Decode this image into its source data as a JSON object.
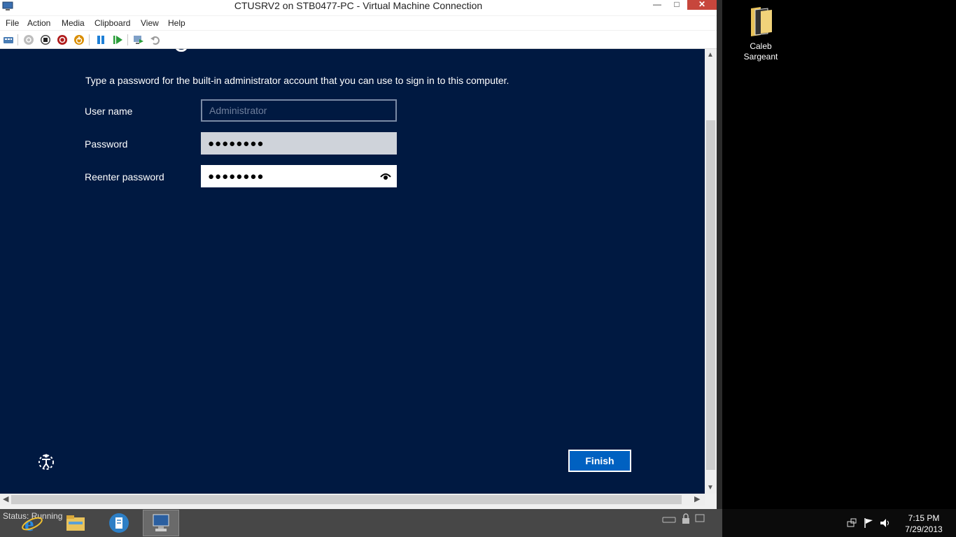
{
  "window": {
    "title": "CTUSRV2 on STB0477-PC - Virtual Machine Connection",
    "minimize_glyph": "—",
    "maximize_glyph": "□",
    "close_glyph": "✕"
  },
  "menu": [
    "File",
    "Action",
    "Media",
    "Clipboard",
    "View",
    "Help"
  ],
  "toolbar": {
    "icons": [
      "ctrl-alt-del-icon",
      "start-icon",
      "turn-off-icon",
      "shut-down-icon",
      "save-icon",
      "pause-icon",
      "reset-icon",
      "checkpoint-icon",
      "revert-icon"
    ]
  },
  "setup": {
    "instruction": "Type a password for the built-in administrator account that you can use to sign in to this computer.",
    "username_label": "User name",
    "username_placeholder": "Administrator",
    "password_label": "Password",
    "password_value": "●●●●●●●●",
    "reenter_label": "Reenter password",
    "reenter_value": "●●●●●●●●",
    "finish_label": "Finish"
  },
  "desktop": {
    "icon_label_line1": "Caleb",
    "icon_label_line2": "Sargeant"
  },
  "statusbar": {
    "text": "Status: Running"
  },
  "taskbar": {
    "apps": [
      "internet-explorer-icon",
      "file-explorer-icon",
      "server-manager-icon",
      "vm-connection-icon"
    ],
    "time": "7:15 PM",
    "date": "7/29/2013"
  },
  "colors": {
    "guest_background": "#001941",
    "finish_button": "#0061c1",
    "close_button": "#c7463c"
  }
}
